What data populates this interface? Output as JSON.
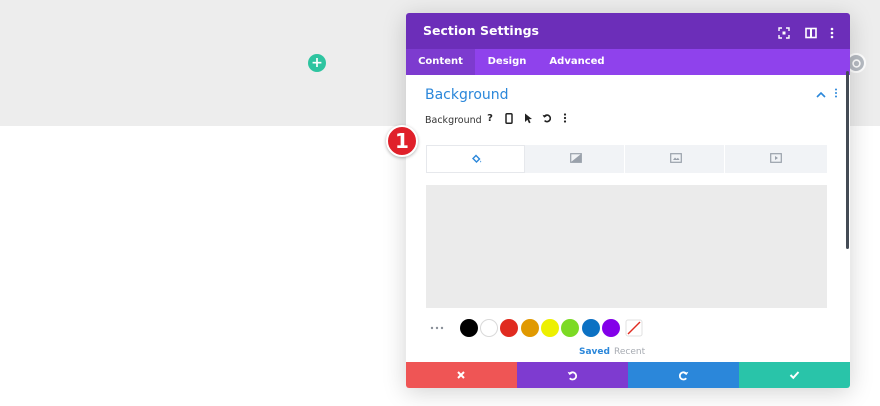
{
  "panel": {
    "title": "Section Settings",
    "tabs": [
      {
        "label": "Content",
        "active": true
      },
      {
        "label": "Design",
        "active": false
      },
      {
        "label": "Advanced",
        "active": false
      }
    ]
  },
  "background_section": {
    "title": "Background",
    "field_label": "Background",
    "field_icons": [
      "help-icon",
      "mobile-icon",
      "cursor-icon",
      "reset-icon",
      "more-icon"
    ],
    "type_tabs": [
      {
        "icon": "paint-bucket-icon",
        "active": true
      },
      {
        "icon": "gradient-icon",
        "active": false
      },
      {
        "icon": "image-icon",
        "active": false
      },
      {
        "icon": "video-icon",
        "active": false
      }
    ]
  },
  "palette": {
    "swatches": [
      "#000000",
      "#ffffff",
      "#e02b20",
      "#e09900",
      "#edf000",
      "#7cda24",
      "#0c71c3",
      "#8300e9"
    ],
    "tabs": {
      "saved": "Saved",
      "recent": "Recent"
    }
  },
  "step_marker": "1",
  "colors": {
    "header": "#6c2eb9",
    "tabs_bar": "#8f42ec",
    "accent": "#2b87da",
    "cancel": "#ef5555",
    "undo": "#7e3bd0",
    "redo": "#2b87da",
    "save": "#29c4a9",
    "add_button": "#2ec4a0",
    "marker": "#e0202a"
  }
}
